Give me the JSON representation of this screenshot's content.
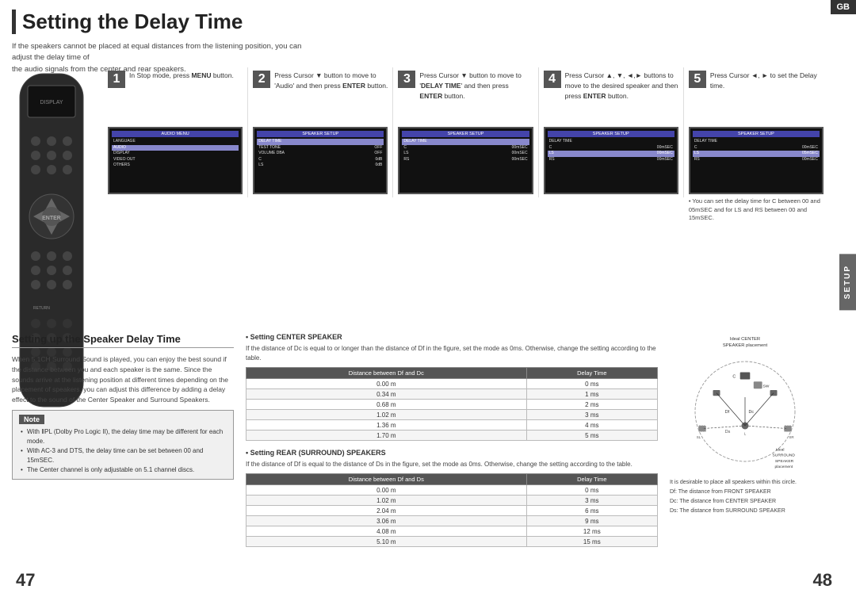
{
  "title": "Setting the Delay Time",
  "gb_badge": "GB",
  "setup_label": "SETUP",
  "page_left": "47",
  "page_right": "48",
  "subtitle": "If the speakers cannot be placed at equal distances from the listening position, you can adjust the delay time of\nthe audio signals from the center and rear speakers.",
  "steps": [
    {
      "number": "1",
      "text": "In Stop mode, press MENU button.",
      "bold_parts": [
        "MENU"
      ]
    },
    {
      "number": "2",
      "text": "Press Cursor ▼ button to move to 'Audio' and then press ENTER button.",
      "bold_parts": [
        "ENTER"
      ]
    },
    {
      "number": "3",
      "text": "Press Cursor ▼ button to move to 'DELAY TIME' and then press ENTER button.",
      "bold_parts": [
        "DELAY TIME",
        "ENTER"
      ]
    },
    {
      "number": "4",
      "text": "Press Cursor ▲, ▼, ◄, ► buttons to move to the desired speaker and then press ENTER button.",
      "bold_parts": [
        "ENTER"
      ]
    },
    {
      "number": "5",
      "text": "Press Cursor ◄, ► to set the Delay time.",
      "note": "• You can set the delay time for C between 00 and 05mSEC and for LS and RS between 00 and 15mSEC."
    }
  ],
  "bottom_title": "Setting up the Speaker Delay Time",
  "bottom_intro": "When 5.1CH Surround Sound is played, you can enjoy the best sound if the distance between you and each speaker is the same. Since the sounds arrive at the listening position at different times depending on the placement of speakers, you can adjust this difference by adding a delay effect to the sound of the Center Speaker and Surround Speakers.",
  "note_title": "Note",
  "note_items": [
    "With ⅡPL (Dolby Pro Logic II), the delay time may be different for each mode.",
    "With AC-3 and DTS, the delay time can be set between 00 and 15mSEC.",
    "The Center channel is only adjustable on 5.1 channel discs."
  ],
  "center_speaker_title": "Setting CENTER SPEAKER",
  "center_speaker_desc": "If the distance of Dc is equal to or longer than the distance of Df in the figure, set the mode as 0ms. Otherwise, change the setting according to the table.",
  "center_table_headers": [
    "Distance between Df and Dc",
    "Delay Time"
  ],
  "center_table_rows": [
    [
      "0.00 m",
      "0 ms"
    ],
    [
      "0.34 m",
      "1 ms"
    ],
    [
      "0.68 m",
      "2 ms"
    ],
    [
      "1.02 m",
      "3 ms"
    ],
    [
      "1.36 m",
      "4 ms"
    ],
    [
      "1.70 m",
      "5 ms"
    ]
  ],
  "rear_speaker_title": "Setting REAR (SURROUND) SPEAKERS",
  "rear_speaker_desc": "If the distance of Df is equal to the distance of Ds in the figure, set the mode as 0ms. Otherwise, change the setting according to the table.",
  "rear_table_headers": [
    "Distance between Df and Ds",
    "Delay Time"
  ],
  "rear_table_rows": [
    [
      "0.00 m",
      "0 ms"
    ],
    [
      "1.02 m",
      "3 ms"
    ],
    [
      "2.04 m",
      "6 ms"
    ],
    [
      "3.06 m",
      "9 ms"
    ],
    [
      "4.08 m",
      "12 ms"
    ],
    [
      "5.10 m",
      "15 ms"
    ]
  ],
  "diagram_title_center": "Ideal CENTER SPEAKER placement",
  "diagram_title_surround": "Ideal SURROUND SPEAKER placement",
  "diagram_labels": [
    "Df: The distance from FRONT SPEAKER",
    "Dc: The distance from CENTER SPEAKER",
    "Ds: The distance from SURROUND SPEAKER"
  ],
  "diagram_circle_note": "It is desirable to place all speakers within this circle.",
  "lcd_screens": [
    {
      "title": "AUDIO MENU",
      "rows": [
        {
          "text": "LANGUAGE",
          "right": ""
        },
        {
          "text": "AUDIO",
          "right": "",
          "selected": true
        },
        {
          "text": "DISPLAY",
          "right": ""
        },
        {
          "text": "VIDEO OUT",
          "right": ""
        },
        {
          "text": "OTHERS",
          "right": ""
        }
      ]
    },
    {
      "title": "SPEAKER SETUP",
      "rows": [
        {
          "text": "DELAY TIME",
          "right": "",
          "selected": true
        },
        {
          "text": "TEST TONE",
          "right": "OFF"
        },
        {
          "text": "VOLUME DBA",
          "right": "OFF"
        },
        {
          "text": "C",
          "right": "0dB"
        },
        {
          "text": "LS",
          "right": "0dB"
        }
      ]
    },
    {
      "title": "SPEAKER SETUP",
      "rows": [
        {
          "text": "DELAY TIME",
          "right": "",
          "selected": true
        },
        {
          "text": "C",
          "right": "00mSEC"
        },
        {
          "text": "LS",
          "right": "00mSEC"
        },
        {
          "text": "RS",
          "right": "00mSEC"
        },
        {
          "text": "",
          "right": ""
        }
      ]
    },
    {
      "title": "SPEAKER SETUP",
      "rows": [
        {
          "text": "DELAY TIME",
          "right": ""
        },
        {
          "text": "C",
          "right": "00mSEC"
        },
        {
          "text": "LS",
          "right": "00mSEC",
          "selected": true
        },
        {
          "text": "RS",
          "right": "00mSEC"
        },
        {
          "text": "",
          "right": ""
        }
      ]
    },
    {
      "title": "SPEAKER SETUP",
      "rows": [
        {
          "text": "DELAY TIME",
          "right": ""
        },
        {
          "text": "C",
          "right": "00mSEC"
        },
        {
          "text": "LS",
          "right": "05mSEC",
          "selected": true
        },
        {
          "text": "RS",
          "right": "00mSEC"
        },
        {
          "text": "",
          "right": ""
        }
      ]
    }
  ]
}
